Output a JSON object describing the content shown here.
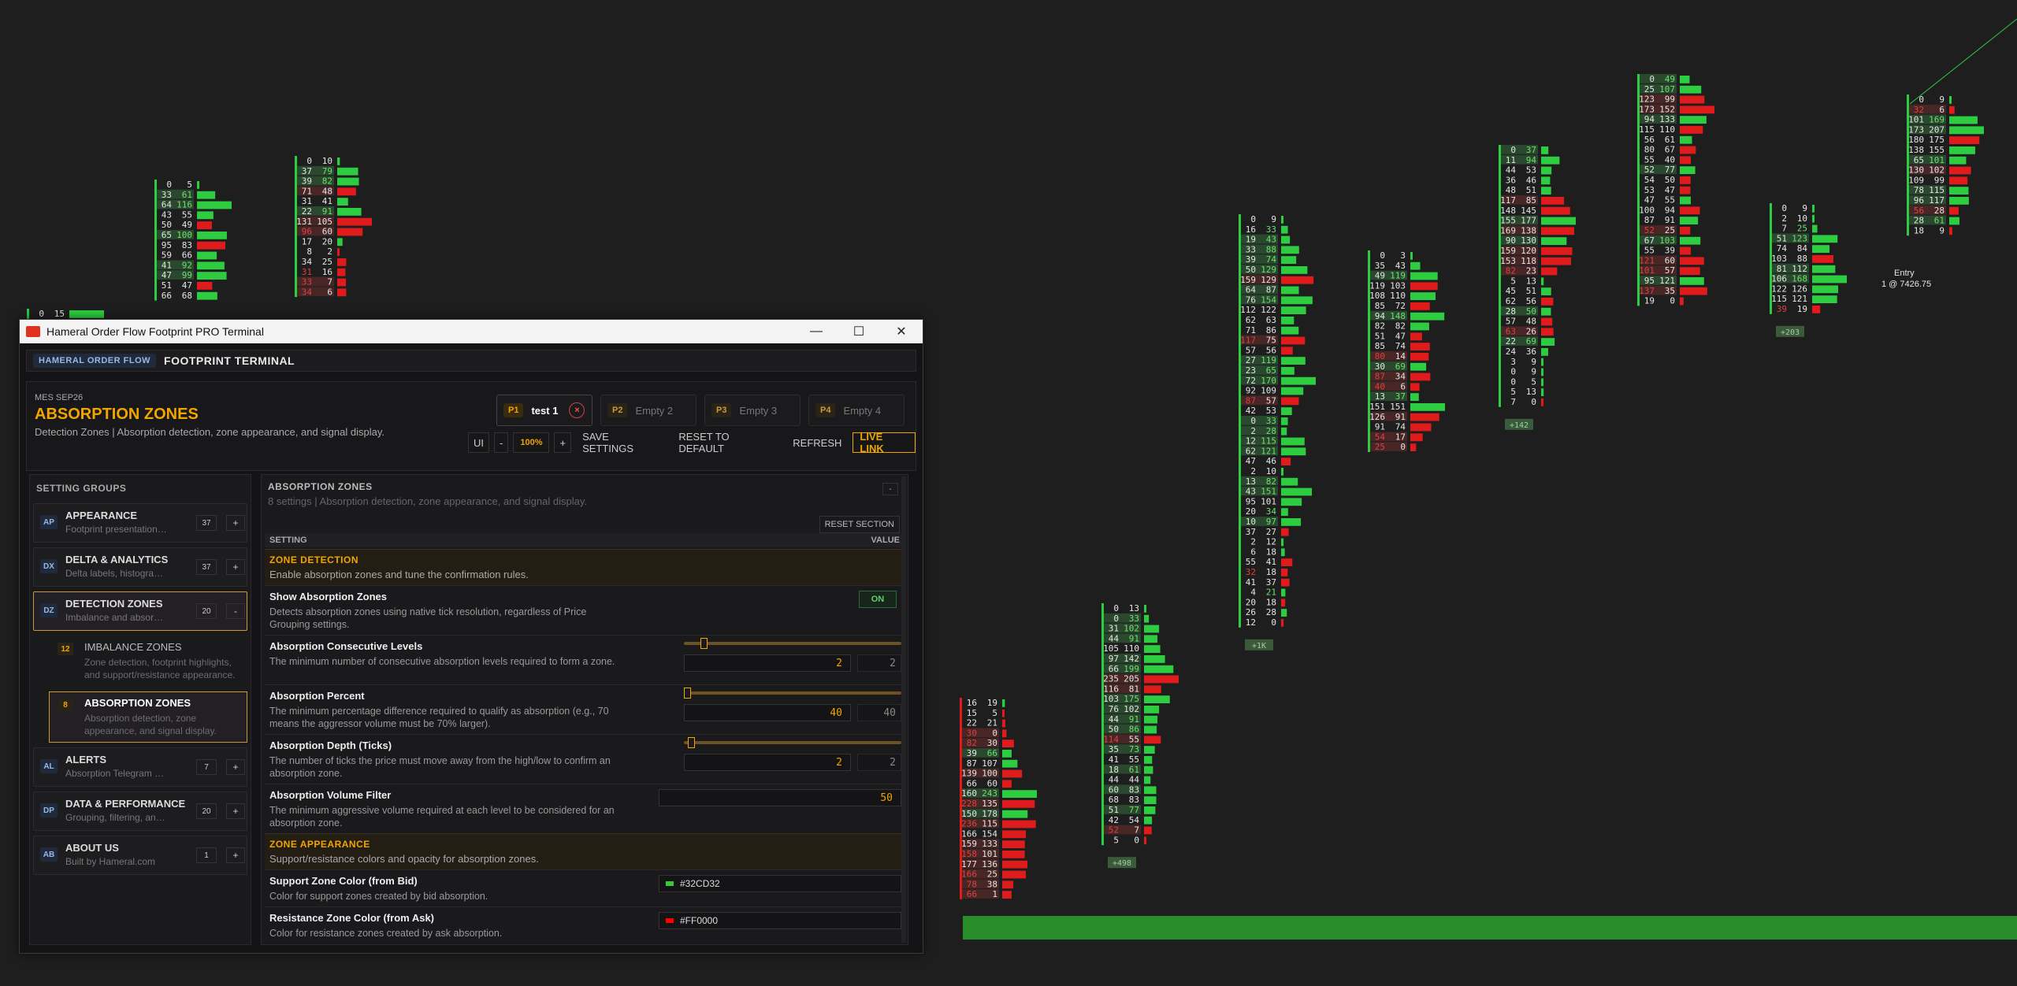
{
  "window": {
    "title": "Hameral Order Flow Footprint PRO Terminal",
    "minimize_glyph": "—",
    "maximize_glyph": "☐",
    "close_glyph": "✕"
  },
  "brand": {
    "tag": "HAMERAL ORDER FLOW",
    "name": "FOOTPRINT TERMINAL"
  },
  "header": {
    "symbol": "MES  SEP26",
    "title": "ABSORPTION ZONES",
    "subtitle": "Detection Zones | Absorption detection, zone appearance, and signal display.",
    "presets": [
      {
        "id": "P1",
        "name": "test 1",
        "close": "×"
      },
      {
        "id": "P2",
        "name": "Empty 2"
      },
      {
        "id": "P3",
        "name": "Empty 3"
      },
      {
        "id": "P4",
        "name": "Empty 4"
      }
    ],
    "toolbar": {
      "ui_label": "UI",
      "minus": "-",
      "zoom": "100%",
      "plus": "+",
      "save": "SAVE SETTINGS",
      "reset": "RESET TO DEFAULT",
      "refresh": "REFRESH",
      "live": "LIVE LINK"
    }
  },
  "sidebar": {
    "title": "SETTING GROUPS",
    "groups": [
      {
        "abbr": "AP",
        "name": "APPEARANCE",
        "desc": "Footprint presentation, ...",
        "count": "37",
        "btn": "+"
      },
      {
        "abbr": "DX",
        "name": "DELTA & ANALYTICS",
        "desc": "Delta labels, histogram, ...",
        "count": "37",
        "btn": "+"
      },
      {
        "abbr": "DZ",
        "name": "DETECTION ZONES",
        "desc": "Imbalance and absorpti...",
        "count": "20",
        "btn": "-"
      },
      {
        "abbr": "AL",
        "name": "ALERTS",
        "desc": "Absorption Telegram de...",
        "count": "7",
        "btn": "+"
      },
      {
        "abbr": "DP",
        "name": "DATA & PERFORMANCE",
        "desc": "Grouping, filtering, and ...",
        "count": "20",
        "btn": "+"
      },
      {
        "abbr": "AB",
        "name": "ABOUT US",
        "desc": "Built by Hameral.com",
        "count": "1",
        "btn": "+"
      }
    ],
    "subs": [
      {
        "count": "12",
        "name": "IMBALANCE ZONES",
        "desc": "Zone detection, footprint highlights, and support/resistance appearance."
      },
      {
        "count": "8",
        "name": "ABSORPTION ZONES",
        "desc": "Absorption detection, zone appearance, and signal display."
      }
    ]
  },
  "main": {
    "title": "ABSORPTION ZONES",
    "subtitle": "8 settings | Absorption detection, zone appearance, and signal display.",
    "collapse": "-",
    "reset_section": "RESET SECTION",
    "col_setting": "SETTING",
    "col_value": "VALUE",
    "sec1": {
      "title": "ZONE DETECTION",
      "desc": "Enable absorption zones and tune the confirmation rules."
    },
    "show": {
      "label": "Show Absorption Zones",
      "desc": "Detects absorption zones using native tick resolution, regardless of Price Grouping settings.",
      "value": "ON"
    },
    "consec": {
      "label": "Absorption Consecutive Levels",
      "desc": "The minimum number of consecutive absorption levels required to form a zone.",
      "value": "2",
      "default": "2",
      "fraction": 0.08
    },
    "percent": {
      "label": "Absorption Percent",
      "desc": "The minimum percentage difference required to qualify as absorption (e.g., 70 means the aggressor volume must be 70% larger).",
      "value": "40",
      "default": "40",
      "fraction": 0.0
    },
    "depth": {
      "label": "Absorption Depth (Ticks)",
      "desc": "The number of ticks the price must move away from the high/low to confirm an absorption zone.",
      "value": "2",
      "default": "2",
      "fraction": 0.02
    },
    "volfilter": {
      "label": "Absorption Volume Filter",
      "desc": "The minimum aggressive volume required at each level to be considered for an absorption zone.",
      "value": "50"
    },
    "sec2": {
      "title": "ZONE APPEARANCE",
      "desc": "Support/resistance colors and opacity for absorption zones."
    },
    "support": {
      "label": "Support Zone Color (from Bid)",
      "desc": "Color for support zones created by bid absorption.",
      "value": "#32CD32",
      "color": "#32CD32"
    },
    "resist": {
      "label": "Resistance Zone Color (from Ask)",
      "desc": "Color for resistance zones created by ask absorption.",
      "value": "#FF0000",
      "color": "#FF0000"
    }
  },
  "chart_data": {
    "type": "table",
    "title": "",
    "columns": [
      {
        "delta": "",
        "rows": [
          [
            "0",
            "15"
          ]
        ]
      },
      {
        "delta": "",
        "rows": [
          [
            "0",
            "5"
          ],
          [
            "33",
            "61"
          ],
          [
            "64",
            "116"
          ],
          [
            "43",
            "55"
          ],
          [
            "50",
            "49"
          ],
          [
            "65",
            "100"
          ],
          [
            "95",
            "83"
          ],
          [
            "59",
            "66"
          ],
          [
            "41",
            "92"
          ],
          [
            "47",
            "99"
          ],
          [
            "51",
            "47"
          ],
          [
            "66",
            "68"
          ]
        ]
      },
      {
        "delta": "",
        "rows": [
          [
            "0",
            "10"
          ],
          [
            "37",
            "79"
          ],
          [
            "39",
            "82"
          ],
          [
            "71",
            "48"
          ],
          [
            "31",
            "41"
          ],
          [
            "22",
            "91"
          ],
          [
            "131",
            "105"
          ],
          [
            "96",
            "60"
          ],
          [
            "17",
            "20"
          ],
          [
            "8",
            "2"
          ],
          [
            "34",
            "25"
          ],
          [
            "31",
            "16"
          ],
          [
            "33",
            "7"
          ],
          [
            "34",
            "6"
          ]
        ]
      },
      {
        "delta": "",
        "rows": [
          [
            "16",
            "19"
          ],
          [
            "15",
            "5"
          ],
          [
            "22",
            "21"
          ],
          [
            "30",
            "0"
          ],
          [
            "82",
            "30"
          ],
          [
            "39",
            "66"
          ],
          [
            "87",
            "107"
          ],
          [
            "139",
            "100"
          ],
          [
            "66",
            "60"
          ],
          [
            "160",
            "243"
          ],
          [
            "228",
            "135"
          ],
          [
            "150",
            "178"
          ],
          [
            "236",
            "115"
          ],
          [
            "166",
            "154"
          ],
          [
            "159",
            "133"
          ],
          [
            "158",
            "101"
          ],
          [
            "177",
            "136"
          ],
          [
            "166",
            "25"
          ],
          [
            "78",
            "38"
          ],
          [
            "66",
            "1"
          ]
        ]
      },
      {
        "delta": "+498",
        "rows": [
          [
            "0",
            "13"
          ],
          [
            "0",
            "33"
          ],
          [
            "31",
            "102"
          ],
          [
            "44",
            "91"
          ],
          [
            "105",
            "110"
          ],
          [
            "97",
            "142"
          ],
          [
            "66",
            "199"
          ],
          [
            "235",
            "205"
          ],
          [
            "116",
            "81"
          ],
          [
            "103",
            "175"
          ],
          [
            "76",
            "102"
          ],
          [
            "44",
            "91"
          ],
          [
            "50",
            "86"
          ],
          [
            "114",
            "55"
          ],
          [
            "35",
            "73"
          ],
          [
            "41",
            "55"
          ],
          [
            "18",
            "61"
          ],
          [
            "44",
            "44"
          ],
          [
            "60",
            "83"
          ],
          [
            "68",
            "83"
          ],
          [
            "51",
            "77"
          ],
          [
            "42",
            "54"
          ],
          [
            "52",
            "7"
          ],
          [
            "5",
            "0"
          ]
        ]
      },
      {
        "delta": "+1K",
        "rows": [
          [
            "0",
            "9"
          ],
          [
            "16",
            "33"
          ],
          [
            "19",
            "43"
          ],
          [
            "33",
            "88"
          ],
          [
            "39",
            "74"
          ],
          [
            "50",
            "129"
          ],
          [
            "159",
            "129"
          ],
          [
            "64",
            "87"
          ],
          [
            "76",
            "154"
          ],
          [
            "112",
            "122"
          ],
          [
            "62",
            "63"
          ],
          [
            "71",
            "86"
          ],
          [
            "117",
            "75"
          ],
          [
            "57",
            "56"
          ],
          [
            "27",
            "119"
          ],
          [
            "23",
            "65"
          ],
          [
            "72",
            "170"
          ],
          [
            "92",
            "109"
          ],
          [
            "87",
            "57"
          ],
          [
            "42",
            "53"
          ],
          [
            "0",
            "33"
          ],
          [
            "2",
            "28"
          ],
          [
            "12",
            "115"
          ],
          [
            "62",
            "121"
          ],
          [
            "47",
            "46"
          ],
          [
            "2",
            "10"
          ],
          [
            "13",
            "82"
          ],
          [
            "43",
            "151"
          ],
          [
            "95",
            "101"
          ],
          [
            "20",
            "34"
          ],
          [
            "10",
            "97"
          ],
          [
            "37",
            "27"
          ],
          [
            "2",
            "12"
          ],
          [
            "6",
            "18"
          ],
          [
            "55",
            "41"
          ],
          [
            "32",
            "18"
          ],
          [
            "41",
            "37"
          ],
          [
            "4",
            "21"
          ],
          [
            "20",
            "18"
          ],
          [
            "26",
            "28"
          ],
          [
            "12",
            "0"
          ]
        ]
      },
      {
        "delta": "",
        "rows": [
          [
            "0",
            "3"
          ],
          [
            "35",
            "43"
          ],
          [
            "49",
            "119"
          ],
          [
            "119",
            "103"
          ],
          [
            "108",
            "110"
          ],
          [
            "85",
            "72"
          ],
          [
            "94",
            "148"
          ],
          [
            "82",
            "82"
          ],
          [
            "51",
            "47"
          ],
          [
            "85",
            "74"
          ],
          [
            "80",
            "14"
          ],
          [
            "30",
            "69"
          ],
          [
            "87",
            "34"
          ],
          [
            "40",
            "6"
          ],
          [
            "13",
            "37"
          ],
          [
            "151",
            "151"
          ],
          [
            "126",
            "91"
          ],
          [
            "91",
            "74"
          ],
          [
            "54",
            "17"
          ],
          [
            "25",
            "0"
          ]
        ]
      },
      {
        "delta": "+142",
        "rows": [
          [
            "0",
            "37"
          ],
          [
            "11",
            "94"
          ],
          [
            "44",
            "53"
          ],
          [
            "36",
            "46"
          ],
          [
            "48",
            "51"
          ],
          [
            "117",
            "85"
          ],
          [
            "148",
            "145"
          ],
          [
            "155",
            "177"
          ],
          [
            "169",
            "138"
          ],
          [
            "90",
            "130"
          ],
          [
            "159",
            "120"
          ],
          [
            "153",
            "118"
          ],
          [
            "82",
            "23"
          ],
          [
            "5",
            "13"
          ],
          [
            "45",
            "51"
          ],
          [
            "62",
            "56"
          ],
          [
            "28",
            "50"
          ],
          [
            "57",
            "48"
          ],
          [
            "63",
            "26"
          ],
          [
            "22",
            "69"
          ],
          [
            "24",
            "36"
          ],
          [
            "3",
            "9"
          ],
          [
            "0",
            "9"
          ],
          [
            "0",
            "5"
          ],
          [
            "5",
            "13"
          ],
          [
            "7",
            "0"
          ]
        ]
      },
      {
        "delta": "",
        "rows": [
          [
            "0",
            "49"
          ],
          [
            "25",
            "107"
          ],
          [
            "123",
            "99"
          ],
          [
            "173",
            "152"
          ],
          [
            "94",
            "133"
          ],
          [
            "115",
            "110"
          ],
          [
            "56",
            "61"
          ],
          [
            "80",
            "67"
          ],
          [
            "55",
            "40"
          ],
          [
            "52",
            "77"
          ],
          [
            "54",
            "50"
          ],
          [
            "53",
            "47"
          ],
          [
            "47",
            "55"
          ],
          [
            "100",
            "94"
          ],
          [
            "87",
            "91"
          ],
          [
            "52",
            "25"
          ],
          [
            "67",
            "103"
          ],
          [
            "55",
            "39"
          ],
          [
            "121",
            "60"
          ],
          [
            "101",
            "57"
          ],
          [
            "95",
            "121"
          ],
          [
            "137",
            "35"
          ],
          [
            "19",
            "0"
          ]
        ]
      },
      {
        "delta": "+203",
        "rows": [
          [
            "0",
            "9"
          ],
          [
            "2",
            "10"
          ],
          [
            "7",
            "25"
          ],
          [
            "51",
            "123"
          ],
          [
            "74",
            "84"
          ],
          [
            "103",
            "88"
          ],
          [
            "81",
            "112"
          ],
          [
            "106",
            "168"
          ],
          [
            "122",
            "126"
          ],
          [
            "115",
            "121"
          ],
          [
            "39",
            "19"
          ]
        ]
      },
      {
        "delta": "",
        "rows": [
          [
            "0",
            "9"
          ],
          [
            "32",
            "6"
          ],
          [
            "101",
            "169"
          ],
          [
            "173",
            "207"
          ],
          [
            "180",
            "175"
          ],
          [
            "138",
            "155"
          ],
          [
            "65",
            "101"
          ],
          [
            "130",
            "102"
          ],
          [
            "109",
            "99"
          ],
          [
            "78",
            "115"
          ],
          [
            "96",
            "117"
          ],
          [
            "56",
            "28"
          ],
          [
            "28",
            "61"
          ],
          [
            "18",
            "9"
          ]
        ]
      }
    ],
    "entry_label": "Entry",
    "entry_value": "1 @ 7426.75"
  }
}
